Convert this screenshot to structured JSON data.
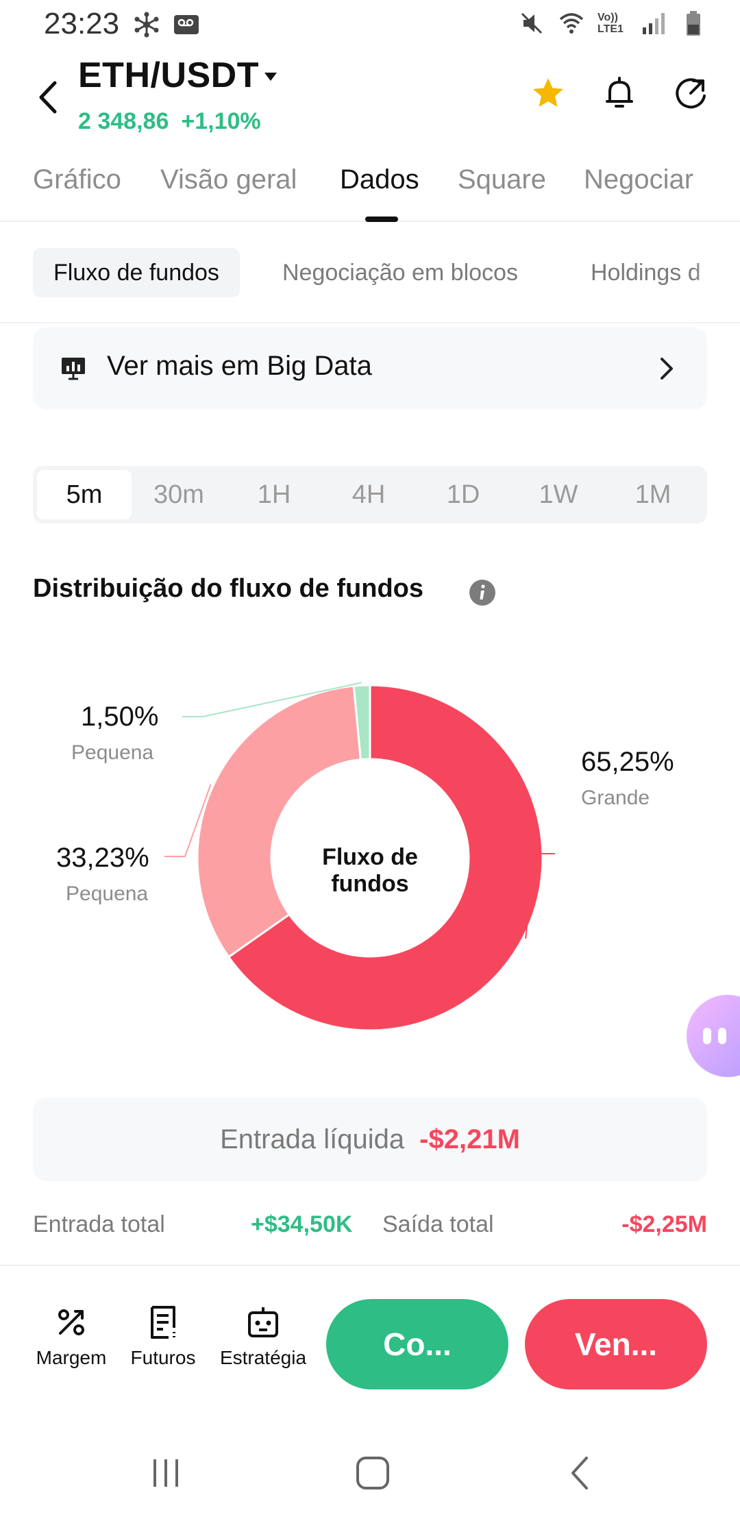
{
  "status_bar": {
    "time": "23:23",
    "network_label": "Vo)) LTE1"
  },
  "header": {
    "pair": "ETH/USDT",
    "price": "2 348,86",
    "change": "+1,10%",
    "price_color": "#2ebd85"
  },
  "main_tabs": [
    {
      "label": "Gráfico",
      "active": false
    },
    {
      "label": "Visão geral",
      "active": false
    },
    {
      "label": "Dados",
      "active": true
    },
    {
      "label": "Square",
      "active": false
    },
    {
      "label": "Negociar",
      "active": false
    }
  ],
  "sub_tabs": [
    {
      "label": "Fluxo de fundos",
      "active": true
    },
    {
      "label": "Negociação em blocos",
      "active": false
    },
    {
      "label": "Holdings d",
      "active": false
    }
  ],
  "big_data_link": {
    "label": "Ver mais em Big Data"
  },
  "timeframes": [
    {
      "label": "5m",
      "active": true
    },
    {
      "label": "30m",
      "active": false
    },
    {
      "label": "1H",
      "active": false
    },
    {
      "label": "4H",
      "active": false
    },
    {
      "label": "1D",
      "active": false
    },
    {
      "label": "1W",
      "active": false
    },
    {
      "label": "1M",
      "active": false
    }
  ],
  "section": {
    "title": "Distribuição do fluxo de fundos"
  },
  "chart_data": {
    "type": "pie",
    "center_label": "Fluxo de fundos",
    "slices": [
      {
        "label": "Grande",
        "value": 65.25,
        "display": "65,25%",
        "color": "#f6465d"
      },
      {
        "label": "Pequena",
        "value": 33.23,
        "display": "33,23%",
        "color": "#fca0a4"
      },
      {
        "label": "Pequena",
        "value": 1.5,
        "display": "1,50%",
        "color": "#a8e6c6"
      }
    ]
  },
  "flow_summary": {
    "net_label": "Entrada líquida",
    "net_value": "-$2,21M",
    "total_in_label": "Entrada total",
    "total_in_value": "+$34,50K",
    "total_out_label": "Saída total",
    "total_out_value": "-$2,25M"
  },
  "action_bar": {
    "margin_label": "Margem",
    "futures_label": "Futuros",
    "strategy_label": "Estratégia",
    "buy_label": "Co...",
    "sell_label": "Ven...",
    "buy_color": "#2ebd85",
    "sell_color": "#f6465d"
  }
}
